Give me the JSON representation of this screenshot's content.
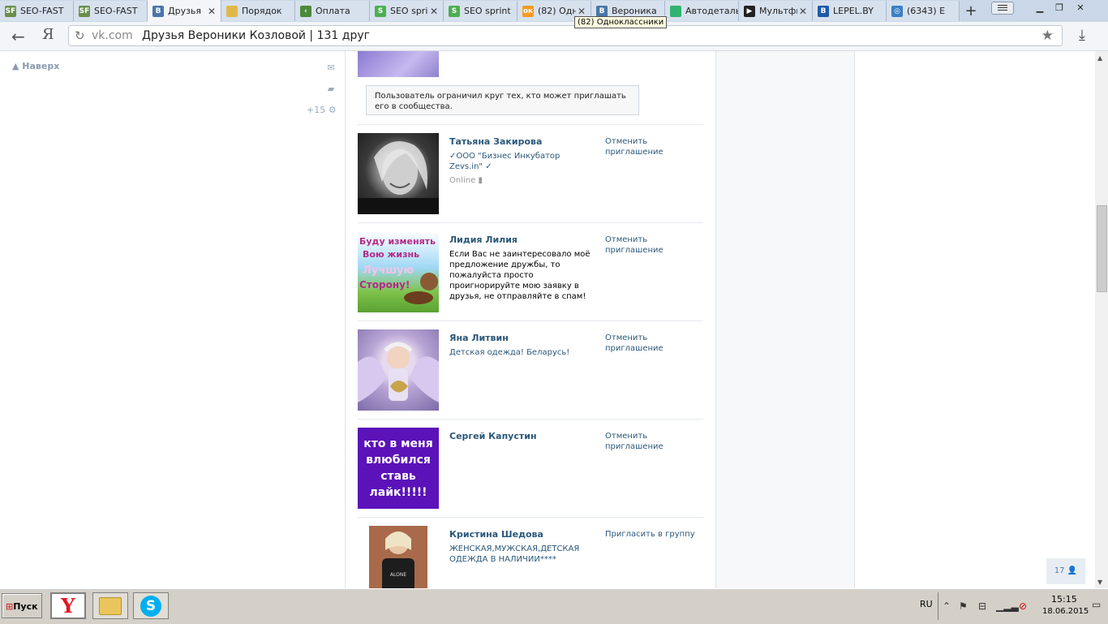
{
  "browser": {
    "tabs": [
      {
        "label": "SEO-FAST",
        "icon": "sf-icon",
        "color": "#6b8e4e",
        "glyph": "SF",
        "close": ""
      },
      {
        "label": "SEO-FAST",
        "icon": "sf-icon",
        "color": "#6b8e4e",
        "glyph": "SF",
        "close": ""
      },
      {
        "label": "Друзья",
        "icon": "vk-icon",
        "color": "#4a76a8",
        "glyph": "B",
        "close": "✕",
        "active": true
      },
      {
        "label": "Порядок",
        "icon": "folder-icon",
        "color": "#e0b84a",
        "glyph": "",
        "close": ""
      },
      {
        "label": "Оплата",
        "icon": "arrow-icon",
        "color": "#4a8a3a",
        "glyph": "‹",
        "close": ""
      },
      {
        "label": "SEO sprint",
        "icon": "seosprint-icon",
        "color": "#4caf50",
        "glyph": "S",
        "close": "✕"
      },
      {
        "label": "SEO sprint",
        "icon": "seosprint-icon",
        "color": "#4caf50",
        "glyph": "S",
        "close": ""
      },
      {
        "label": "(82) Одноклассники",
        "icon": "ok-icon",
        "color": "#f59a23",
        "glyph": "ок",
        "close": "✕"
      },
      {
        "label": "Вероника",
        "icon": "vk-icon",
        "color": "#4a76a8",
        "glyph": "B",
        "close": ""
      },
      {
        "label": "Автодеталь",
        "icon": "green-icon",
        "color": "#2fb36f",
        "glyph": "",
        "close": ""
      },
      {
        "label": "Мультфильмы",
        "icon": "play-icon",
        "color": "#222222",
        "glyph": "▶",
        "close": "✕"
      },
      {
        "label": "LEPEL.BY",
        "icon": "lepel-icon",
        "color": "#1e5aa8",
        "glyph": "B",
        "close": ""
      },
      {
        "label": "(6343) E",
        "icon": "circle-icon",
        "color": "#3b7fc4",
        "glyph": "◎",
        "close": ""
      }
    ],
    "tooltip": "(82) Одноклассники",
    "new_tab": "+",
    "url_domain": "vk.com",
    "url_title": "Друзья Вероники Козловой | 131 друг"
  },
  "sidebar": {
    "up_link": "Наверх",
    "counter": "+15"
  },
  "notice": "Пользователь ограничил круг тех, кто может приглашать его в сообщества.",
  "friends": [
    {
      "name": "Татьяна Закирова",
      "desc": "✓ООО \"Бизнес Инкубатор Zevs.in\" ✓",
      "desc_blue": true,
      "online": "Online",
      "action": "Отменить приглашение"
    },
    {
      "name": "Лидия Лилия",
      "desc": "Если Вас не заинтересовало моё предложение дружбы, то пожалуйста просто проигнорируйте мою заявку в друзья, не отправляйте в спам!",
      "desc_blue": false,
      "online": "",
      "action": "Отменить приглашение"
    },
    {
      "name": "Яна Литвин",
      "desc": "Детская одежда! Беларусь!",
      "desc_blue": true,
      "online": "",
      "action": "Отменить приглашение"
    },
    {
      "name": "Сергей Капустин",
      "desc": "",
      "desc_blue": false,
      "online": "",
      "action": "Отменить приглашение"
    },
    {
      "name": "Кристина Шедова",
      "desc": "ЖЕНСКАЯ,МУЖСКАЯ,ДЕТСКАЯ ОДЕЖДА В НАЛИЧИИ****",
      "desc_blue": true,
      "online": "",
      "action": "Пригласить в группу"
    }
  ],
  "photo_texts": {
    "lidia": [
      "Буду изменять",
      "Вою жизнь",
      "Лучшую",
      "Сторону!"
    ],
    "sergey": [
      "кто в меня",
      "влюбился",
      "ставь",
      "лайк!!!!!"
    ]
  },
  "friends_count": "17",
  "taskbar": {
    "start": "Пуск",
    "lang": "RU",
    "time": "15:15",
    "date": "18.06.2015"
  }
}
